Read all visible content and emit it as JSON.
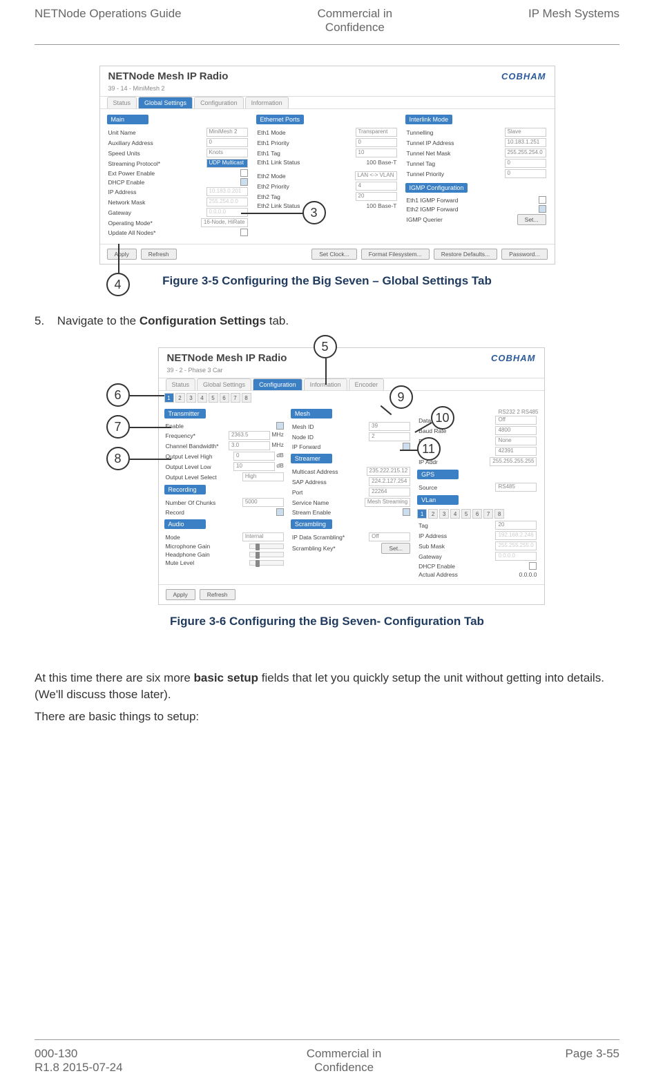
{
  "header": {
    "left": "NETNode Operations Guide",
    "center_l1": "Commercial in",
    "center_l2": "Confidence",
    "right": "IP Mesh Systems"
  },
  "fig1": {
    "panel_title": "NETNode Mesh IP Radio",
    "logo": "COBHAM",
    "subhead": "39 - 14 - MiniMesh 2",
    "tabs": [
      "Status",
      "Global Settings",
      "Configuration",
      "Information"
    ],
    "active_tab": 1,
    "sections": {
      "main": {
        "header": "Main",
        "rows": [
          {
            "lbl": "Unit Name",
            "val": "MiniMesh 2"
          },
          {
            "lbl": "Auxiliary Address",
            "val": "0"
          },
          {
            "lbl": "Speed Units",
            "val": "Knots"
          },
          {
            "lbl": "Streaming Protocol*",
            "val": "UDP Multicast"
          },
          {
            "lbl": "Ext Power Enable",
            "check": false
          },
          {
            "lbl": "DHCP Enable",
            "check": true
          },
          {
            "lbl": "IP Address",
            "val": "10.183.0.201"
          },
          {
            "lbl": "Network Mask",
            "val": "255.254.0.0"
          },
          {
            "lbl": "Gateway",
            "val": "0.0.0.0"
          },
          {
            "lbl": "Operating Mode*",
            "val": "16-Node, HiRate"
          },
          {
            "lbl": "Update All Nodes*",
            "check": false
          }
        ]
      },
      "eth": {
        "header": "Ethernet Ports",
        "rows": [
          {
            "lbl": "Eth1 Mode",
            "val": "Transparent"
          },
          {
            "lbl": "Eth1 Priority",
            "val": "0"
          },
          {
            "lbl": "Eth1 Tag",
            "val": "10"
          },
          {
            "lbl": "Eth1 Link Status",
            "val": "100 Base-T"
          },
          {
            "lbl": "Eth2 Mode",
            "val": "LAN <-> VLAN"
          },
          {
            "lbl": "Eth2 Priority",
            "val": "4"
          },
          {
            "lbl": "Eth2 Tag",
            "val": "20"
          },
          {
            "lbl": "Eth2 Link Status",
            "val": "100 Base-T"
          }
        ]
      },
      "interlink": {
        "header": "Interlink Mode",
        "rows": [
          {
            "lbl": "Tunnelling",
            "val": "Slave"
          },
          {
            "lbl": "Tunnel IP Address",
            "val": "10.183.1.251"
          },
          {
            "lbl": "Tunnel Net Mask",
            "val": "255.255.254.0"
          },
          {
            "lbl": "Tunnel Tag",
            "val": "0"
          },
          {
            "lbl": "Tunnel Priority",
            "val": "0"
          }
        ]
      },
      "igmp": {
        "header": "IGMP Configuration",
        "rows": [
          {
            "lbl": "Eth1 IGMP Forward",
            "check": false
          },
          {
            "lbl": "Eth2 IGMP Forward",
            "check": true
          },
          {
            "lbl": "IGMP Querier",
            "btn": "Set..."
          }
        ]
      }
    },
    "buttons": [
      "Apply",
      "Refresh",
      "Set Clock...",
      "Format Filesystem...",
      "Restore Defaults...",
      "Password..."
    ],
    "callouts": {
      "c3": "3",
      "c4": "4"
    },
    "caption": "Figure 3-5 Configuring the Big Seven – Global Settings Tab"
  },
  "step5": {
    "num": "5.",
    "text_pre": "Navigate to the ",
    "text_bold": "Configuration Settings",
    "text_post": " tab."
  },
  "fig2": {
    "panel_title": "NETNode Mesh IP Radio",
    "logo": "COBHAM",
    "subhead": "39 - 2 - Phase 3 Car",
    "tabs": [
      "Status",
      "Global Settings",
      "Configuration",
      "Information",
      "Encoder"
    ],
    "active_tab": 2,
    "numtabs": [
      "1",
      "2",
      "3",
      "4",
      "5",
      "6",
      "7",
      "8"
    ],
    "sections": {
      "transmitter": {
        "header": "Transmitter",
        "rows": [
          {
            "lbl": "Enable",
            "check": true
          },
          {
            "lbl": "Frequency*",
            "val": "2363.5",
            "unit": "MHz"
          },
          {
            "lbl": "Channel Bandwidth*",
            "val": "3.0",
            "unit": "MHz"
          },
          {
            "lbl": "Output Level High",
            "val": "0",
            "unit": "dB"
          },
          {
            "lbl": "Output Level Low",
            "val": "10",
            "unit": "dB"
          },
          {
            "lbl": "Output Level Select",
            "val": "High"
          }
        ]
      },
      "recording": {
        "header": "Recording",
        "rows": [
          {
            "lbl": "Number Of Chunks",
            "val": "5000"
          },
          {
            "lbl": "Record",
            "check": true
          }
        ]
      },
      "audio": {
        "header": "Audio",
        "rows": [
          {
            "lbl": "Mode",
            "val": "Internal"
          },
          {
            "lbl": "Microphone Gain",
            "slider": true
          },
          {
            "lbl": "Headphone Gain",
            "slider": true
          },
          {
            "lbl": "Mute Level",
            "slider": true
          }
        ]
      },
      "mesh": {
        "header": "Mesh",
        "rows": [
          {
            "lbl": "Mesh ID",
            "val": "39"
          },
          {
            "lbl": "Node ID",
            "val": "2"
          },
          {
            "lbl": "IP Forward",
            "check": true
          }
        ]
      },
      "streamer": {
        "header": "Streamer",
        "rows": [
          {
            "lbl": "Multicast Address",
            "val": "235.222.215.12"
          },
          {
            "lbl": "SAP Address",
            "val": "224.2.127.254"
          },
          {
            "lbl": "Port",
            "val": "22264"
          },
          {
            "lbl": "Service Name",
            "val": "Mesh Streaming"
          },
          {
            "lbl": "Stream Enable",
            "check": true
          }
        ]
      },
      "scrambling": {
        "header": "Scrambling",
        "rows": [
          {
            "lbl": "IP Data Scrambling*",
            "val": "Off"
          },
          {
            "lbl": "Scrambling Key*",
            "btn": "Set..."
          }
        ]
      },
      "data": {
        "header": "Data",
        "sublabel": "RS232 2    RS485",
        "rows": [
          {
            "lbl": "Data",
            "val": "Off"
          },
          {
            "lbl": "Baud Rate",
            "val": "4800"
          },
          {
            "lbl": "Parity",
            "val": "None"
          },
          {
            "lbl": "IP Port",
            "val": "42391"
          },
          {
            "lbl": "IP Addr",
            "val": "255.255.255.255"
          }
        ]
      },
      "gps": {
        "header": "GPS",
        "rows": [
          {
            "lbl": "Source",
            "val": "RS485"
          }
        ]
      },
      "vlan": {
        "header": "VLan",
        "numtabs": [
          "1",
          "2",
          "3",
          "4",
          "5",
          "6",
          "7",
          "8"
        ],
        "rows": [
          {
            "lbl": "Tag",
            "val": "20"
          },
          {
            "lbl": "IP Address",
            "val": "192.168.2.246"
          },
          {
            "lbl": "Sub Mask",
            "val": "255.255.255.0"
          },
          {
            "lbl": "Gateway",
            "val": "0.0.0.0"
          },
          {
            "lbl": "DHCP Enable",
            "check": false
          },
          {
            "lbl": "Actual Address",
            "val": "0.0.0.0"
          }
        ]
      }
    },
    "buttons": [
      "Apply",
      "Refresh"
    ],
    "callouts": {
      "c5": "5",
      "c6": "6",
      "c7": "7",
      "c8": "8",
      "c9": "9",
      "c10": "10",
      "c11": "11"
    },
    "caption": "Figure 3-6 Configuring the Big Seven- Configuration Tab"
  },
  "body": {
    "p1_pre": "At this time there are six more ",
    "p1_bold": "basic setup",
    "p1_post": " fields that let you quickly setup the unit without getting into details. (We'll discuss those later).",
    "p2": "There are basic things to setup:"
  },
  "footer": {
    "left_l1": "000-130",
    "left_l2": "R1.8 2015-07-24",
    "center_l1": "Commercial in",
    "center_l2": "Confidence",
    "right": "Page 3-55"
  }
}
